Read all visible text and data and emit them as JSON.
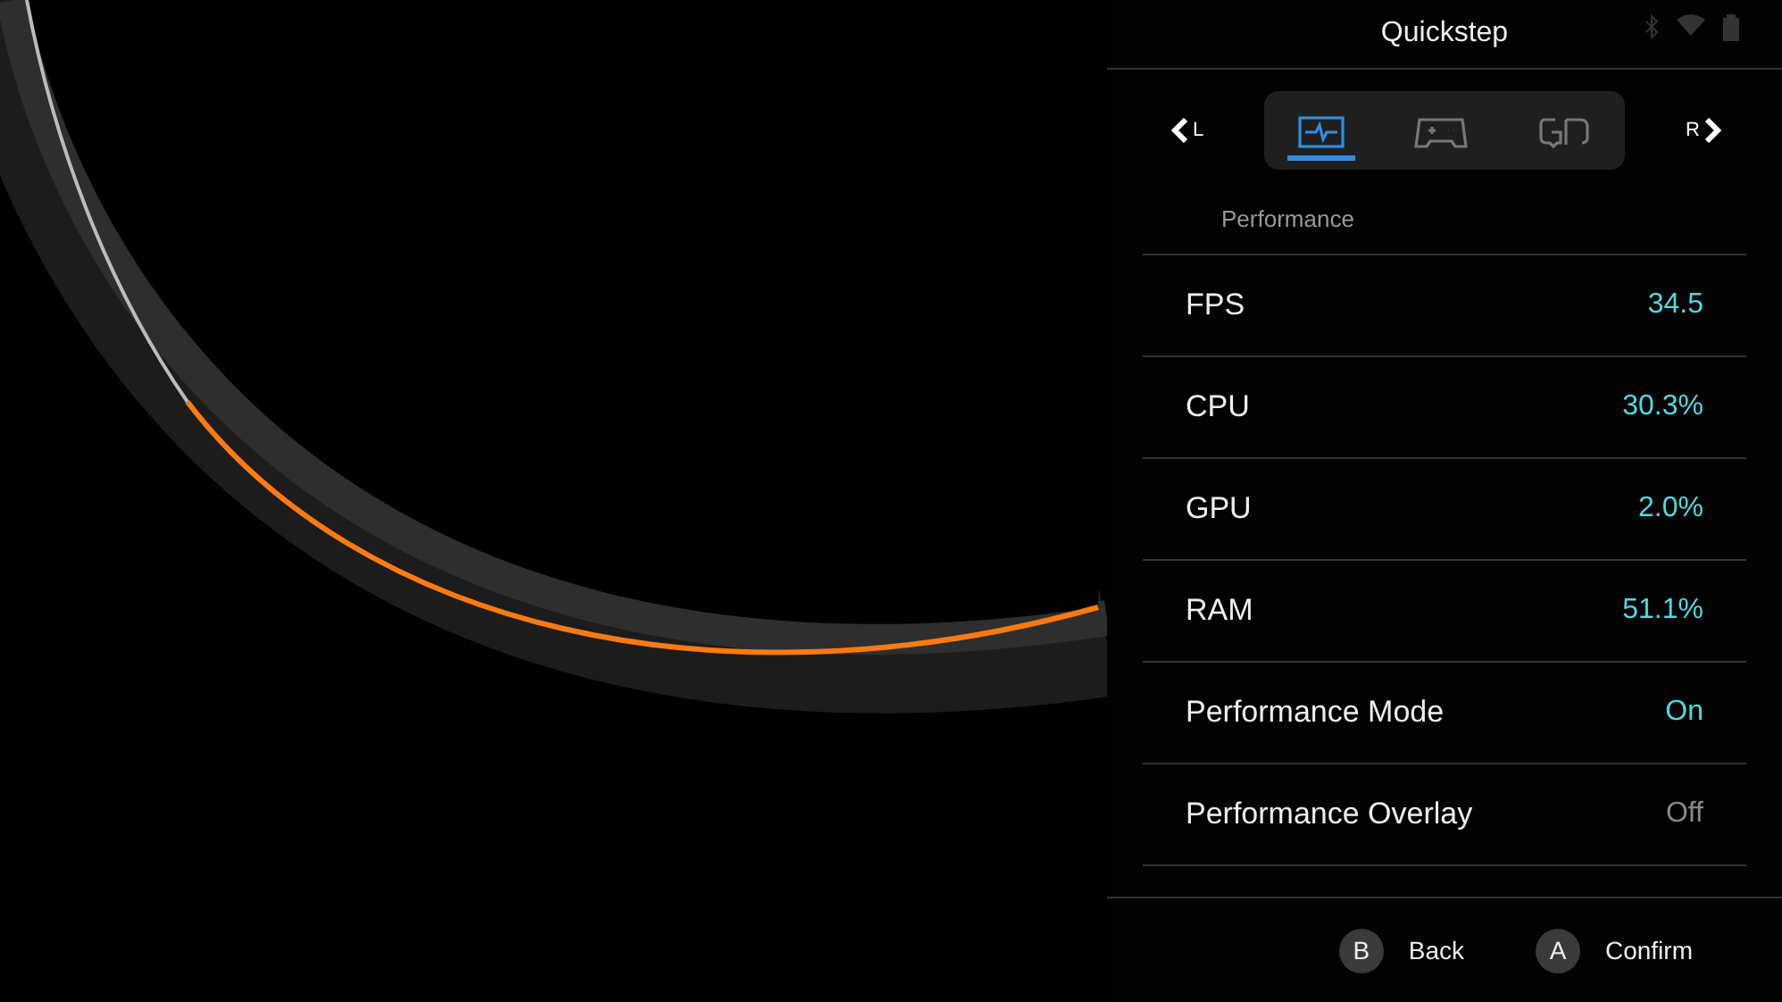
{
  "panel": {
    "title": "Quickstep"
  },
  "tab_nav": {
    "left": "L",
    "right": "R",
    "tabs": [
      {
        "kind": "performance",
        "selected": true
      },
      {
        "kind": "controller",
        "selected": false
      },
      {
        "kind": "gyro",
        "selected": false
      }
    ]
  },
  "section": "Performance",
  "rows": [
    {
      "label": "FPS",
      "value": "34.5",
      "kind": "metric"
    },
    {
      "label": "CPU",
      "value": "30.3%",
      "kind": "metric"
    },
    {
      "label": "GPU",
      "value": "2.0%",
      "kind": "metric"
    },
    {
      "label": "RAM",
      "value": "51.1%",
      "kind": "metric"
    },
    {
      "label": "Performance Mode",
      "value": "On",
      "kind": "toggle",
      "on": true
    },
    {
      "label": "Performance Overlay",
      "value": "Off",
      "kind": "toggle",
      "on": false
    }
  ],
  "footer": [
    {
      "key": "B",
      "label": "Back"
    },
    {
      "key": "A",
      "label": "Confirm"
    }
  ]
}
